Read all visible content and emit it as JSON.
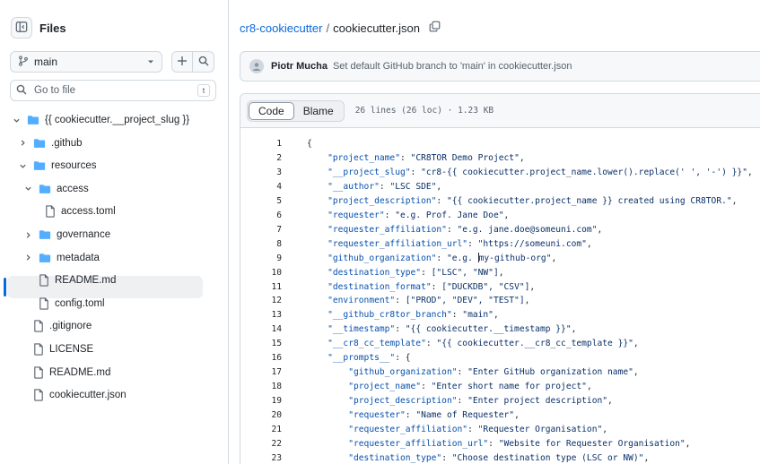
{
  "sidebar": {
    "title": "Files",
    "branch": "main",
    "goto_placeholder": "Go to file",
    "goto_shortcut": "t",
    "tree": [
      {
        "label": "{{ cookiecutter.__project_slug }}",
        "type": "folder",
        "expanded": true,
        "depth": 0
      },
      {
        "label": ".github",
        "type": "folder",
        "expanded": false,
        "depth": 1
      },
      {
        "label": "resources",
        "type": "folder",
        "expanded": true,
        "depth": 1
      },
      {
        "label": "access",
        "type": "folder",
        "expanded": true,
        "depth": 2
      },
      {
        "label": "access.toml",
        "type": "file",
        "depth": 3
      },
      {
        "label": "governance",
        "type": "folder",
        "expanded": false,
        "depth": 2
      },
      {
        "label": "metadata",
        "type": "folder",
        "expanded": false,
        "depth": 2
      },
      {
        "label": "README.md",
        "type": "file",
        "depth": 2
      },
      {
        "label": "config.toml",
        "type": "file",
        "depth": 2
      },
      {
        "label": ".gitignore",
        "type": "file",
        "depth": 1
      },
      {
        "label": "LICENSE",
        "type": "file",
        "depth": 1
      },
      {
        "label": "README.md",
        "type": "file",
        "depth": 1
      },
      {
        "label": "cookiecutter.json",
        "type": "file",
        "depth": 1,
        "selected": true
      }
    ]
  },
  "breadcrumb": {
    "repo": "cr8-cookiecutter",
    "separator": "/",
    "file": "cookiecutter.json"
  },
  "commit": {
    "author": "Piotr Mucha",
    "message": "Set default GitHub branch to 'main' in cookiecutter.json"
  },
  "file_view": {
    "tabs": [
      "Code",
      "Blame"
    ],
    "active_tab": "Code",
    "info": "26 lines (26 loc) · 1.23 KB"
  },
  "code_lines": [
    {
      "n": "1",
      "indent": "",
      "key": "",
      "val": "{",
      "tail": ""
    },
    {
      "n": "2",
      "indent": "    ",
      "key": "\"project_name\"",
      "val": "\"CR8TOR Demo Project\"",
      "tail": ","
    },
    {
      "n": "3",
      "indent": "    ",
      "key": "\"__project_slug\"",
      "val": "\"cr8-{{ cookiecutter.project_name.lower().replace(' ', '-') }}\"",
      "tail": ","
    },
    {
      "n": "4",
      "indent": "    ",
      "key": "\"__author\"",
      "val": "\"LSC SDE\"",
      "tail": ","
    },
    {
      "n": "5",
      "indent": "    ",
      "key": "\"project_description\"",
      "val": "\"{{ cookiecutter.project_name }} created using CR8TOR.\"",
      "tail": ","
    },
    {
      "n": "6",
      "indent": "    ",
      "key": "\"requester\"",
      "val": "\"e.g. Prof. Jane Doe\"",
      "tail": ","
    },
    {
      "n": "7",
      "indent": "    ",
      "key": "\"requester_affiliation\"",
      "val": "\"e.g. jane.doe@someuni.com\"",
      "tail": ","
    },
    {
      "n": "8",
      "indent": "    ",
      "key": "\"requester_affiliation_url\"",
      "val": "\"https://someuni.com\"",
      "tail": ","
    },
    {
      "n": "9",
      "indent": "    ",
      "key": "\"github_organization\"",
      "val": "\"e.g. my-github-org\"",
      "tail": ","
    },
    {
      "n": "10",
      "indent": "    ",
      "key": "\"destination_type\"",
      "val": "[\"LSC\", \"NW\"]",
      "tail": ","
    },
    {
      "n": "11",
      "indent": "    ",
      "key": "\"destination_format\"",
      "val": "[\"DUCKDB\", \"CSV\"]",
      "tail": ","
    },
    {
      "n": "12",
      "indent": "    ",
      "key": "\"environment\"",
      "val": "[\"PROD\", \"DEV\", \"TEST\"]",
      "tail": ","
    },
    {
      "n": "13",
      "indent": "    ",
      "key": "\"__github_cr8tor_branch\"",
      "val": "\"main\"",
      "tail": ","
    },
    {
      "n": "14",
      "indent": "    ",
      "key": "\"__timestamp\"",
      "val": "\"{{ cookiecutter.__timestamp }}\"",
      "tail": ","
    },
    {
      "n": "15",
      "indent": "    ",
      "key": "\"__cr8_cc_template\"",
      "val": "\"{{ cookiecutter.__cr8_cc_template }}\"",
      "tail": ","
    },
    {
      "n": "16",
      "indent": "    ",
      "key": "\"__prompts__\"",
      "val": "{",
      "tail": ""
    },
    {
      "n": "17",
      "indent": "        ",
      "key": "\"github_organization\"",
      "val": "\"Enter GitHub organization name\"",
      "tail": ","
    },
    {
      "n": "18",
      "indent": "        ",
      "key": "\"project_name\"",
      "val": "\"Enter short name for project\"",
      "tail": ","
    },
    {
      "n": "19",
      "indent": "        ",
      "key": "\"project_description\"",
      "val": "\"Enter project description\"",
      "tail": ","
    },
    {
      "n": "20",
      "indent": "        ",
      "key": "\"requester\"",
      "val": "\"Name of Requester\"",
      "tail": ","
    },
    {
      "n": "21",
      "indent": "        ",
      "key": "\"requester_affiliation\"",
      "val": "\"Requester Organisation\"",
      "tail": ","
    },
    {
      "n": "22",
      "indent": "        ",
      "key": "\"requester_affiliation_url\"",
      "val": "\"Website for Requester Organisation\"",
      "tail": ","
    },
    {
      "n": "23",
      "indent": "        ",
      "key": "\"destination_type\"",
      "val": "\"Choose destination type (LSC or NW)\"",
      "tail": ","
    }
  ],
  "colors": {
    "link": "#0969da",
    "folder": "#54aeff",
    "selected_bar": "#0969da",
    "json_key": "#0550ae",
    "json_string": "#0a3069"
  }
}
